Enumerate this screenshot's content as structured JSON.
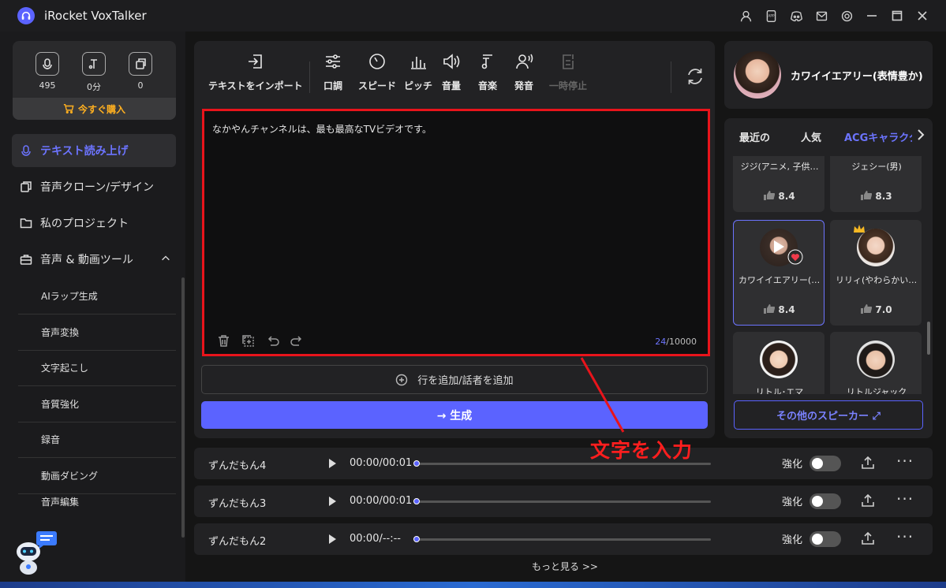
{
  "app": {
    "title": "iRocket VoxTalker"
  },
  "stats": {
    "chars": "495",
    "minutes": "0分",
    "count": "0",
    "buy_label": "今すぐ購入"
  },
  "nav": {
    "tts": "テキスト読み上げ",
    "clone": "音声クローン/デザイン",
    "projects": "私のプロジェクト",
    "tools": "音声 & 動画ツール",
    "sub": [
      "AIラップ生成",
      "音声変換",
      "文字起こし",
      "音質強化",
      "録音",
      "動画ダビング",
      "音声編集"
    ]
  },
  "toolbar": {
    "import": "テキストをインポート",
    "tone": "口調",
    "speed": "スピード",
    "pitch": "ピッチ",
    "volume": "音量",
    "music": "音楽",
    "pronunciation": "発音",
    "pause": "一時停止"
  },
  "editor": {
    "text": "なかやんチャンネルは、最も最高なTVビデオです。",
    "count_current": "24",
    "count_max": "/10000"
  },
  "add_line_label": "行を追加/話者を追加",
  "generate_label": "→ 生成",
  "annotation": "文字を入力",
  "speaker": {
    "name": "カワイイエアリー(表情豊か)"
  },
  "voice_tabs": [
    "最近の",
    "人気",
    "ACGキャラクター"
  ],
  "voices": [
    {
      "name": "ジジ(アニメ, 子供…",
      "score": "8.4"
    },
    {
      "name": "ジェシー(男)",
      "score": "8.3"
    },
    {
      "name": "カワイイエアリー(表…",
      "score": "8.4"
    },
    {
      "name": "リリィ(やわらかい, …",
      "score": "7.0"
    },
    {
      "name": "リトル･エマ",
      "score": ""
    },
    {
      "name": "リトルジャック",
      "score": ""
    }
  ],
  "more_speakers": "その他のスピーカー ⤢",
  "tracks": [
    {
      "name": "ずんだもん4",
      "time": "00:00/00:01"
    },
    {
      "name": "ずんだもん3",
      "time": "00:00/00:01"
    },
    {
      "name": "ずんだもん2",
      "time": "00:00/--:--"
    }
  ],
  "enhance_label": "強化",
  "more_link": "もっと見る >>",
  "colors": {
    "accent": "#5b63ff",
    "annotation": "#e8141b",
    "warning": "#ffb020"
  }
}
